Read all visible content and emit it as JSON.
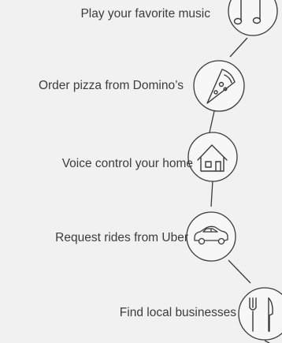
{
  "features": [
    {
      "label": "Play your favorite music",
      "icon": "music-note-icon"
    },
    {
      "label": "Order pizza from Domino’s",
      "icon": "pizza-slice-icon"
    },
    {
      "label": "Voice control your home",
      "icon": "home-icon"
    },
    {
      "label": "Request rides from Uber",
      "icon": "car-icon"
    },
    {
      "label": "Find local businesses",
      "icon": "fork-knife-icon"
    }
  ],
  "colors": {
    "background": "#f1f1f1",
    "line": "#3a3a3a",
    "text": "#3c3c3c",
    "circle_fill": "#f7f7f7"
  }
}
